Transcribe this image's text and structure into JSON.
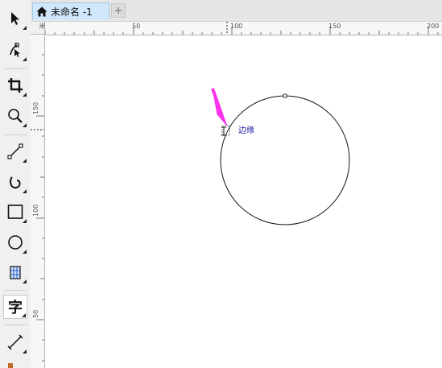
{
  "toolbox": {
    "tools": [
      {
        "name": "pick-tool",
        "icon": "arrow-pointer-icon"
      },
      {
        "name": "shape-tool",
        "icon": "node-edit-icon"
      },
      {
        "name": "crop-tool",
        "icon": "crop-icon"
      },
      {
        "name": "zoom-tool",
        "icon": "magnifier-icon"
      },
      {
        "name": "freehand-tool",
        "icon": "line-pen-icon"
      },
      {
        "name": "artistic-media-tool",
        "icon": "curve-icon"
      },
      {
        "name": "rectangle-tool",
        "icon": "rectangle-icon"
      },
      {
        "name": "ellipse-tool",
        "icon": "ellipse-icon"
      },
      {
        "name": "table-tool",
        "icon": "table-grid-icon"
      },
      {
        "name": "text-tool",
        "icon": "text-icon",
        "glyph": "字",
        "active": true
      },
      {
        "name": "dimension-tool",
        "icon": "dimension-line-icon"
      }
    ]
  },
  "tabs": {
    "document_title": "未命名 -1",
    "home_icon": "home-icon",
    "add_icon": "plus-icon"
  },
  "ruler": {
    "h_labels": [
      "50",
      "100",
      "150",
      "200"
    ],
    "v_labels": [
      "150",
      "100",
      "50"
    ],
    "unit_vertical": "米"
  },
  "canvas": {
    "snap_label": "边缘",
    "snap_label_color": "#1a1aa6",
    "pointer_color": "#ff33ee"
  }
}
